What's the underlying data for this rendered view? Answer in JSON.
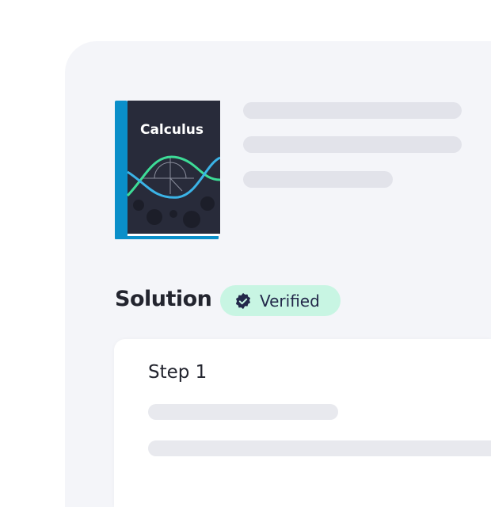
{
  "book": {
    "title": "Calculus",
    "spine_color": "#0a8fc9",
    "cover_color": "#282b3a"
  },
  "solution": {
    "heading": "Solution",
    "badge_label": "Verified",
    "badge_icon": "verified-check-icon",
    "badge_color": "#c8f5e3"
  },
  "step": {
    "title": "Step 1"
  }
}
